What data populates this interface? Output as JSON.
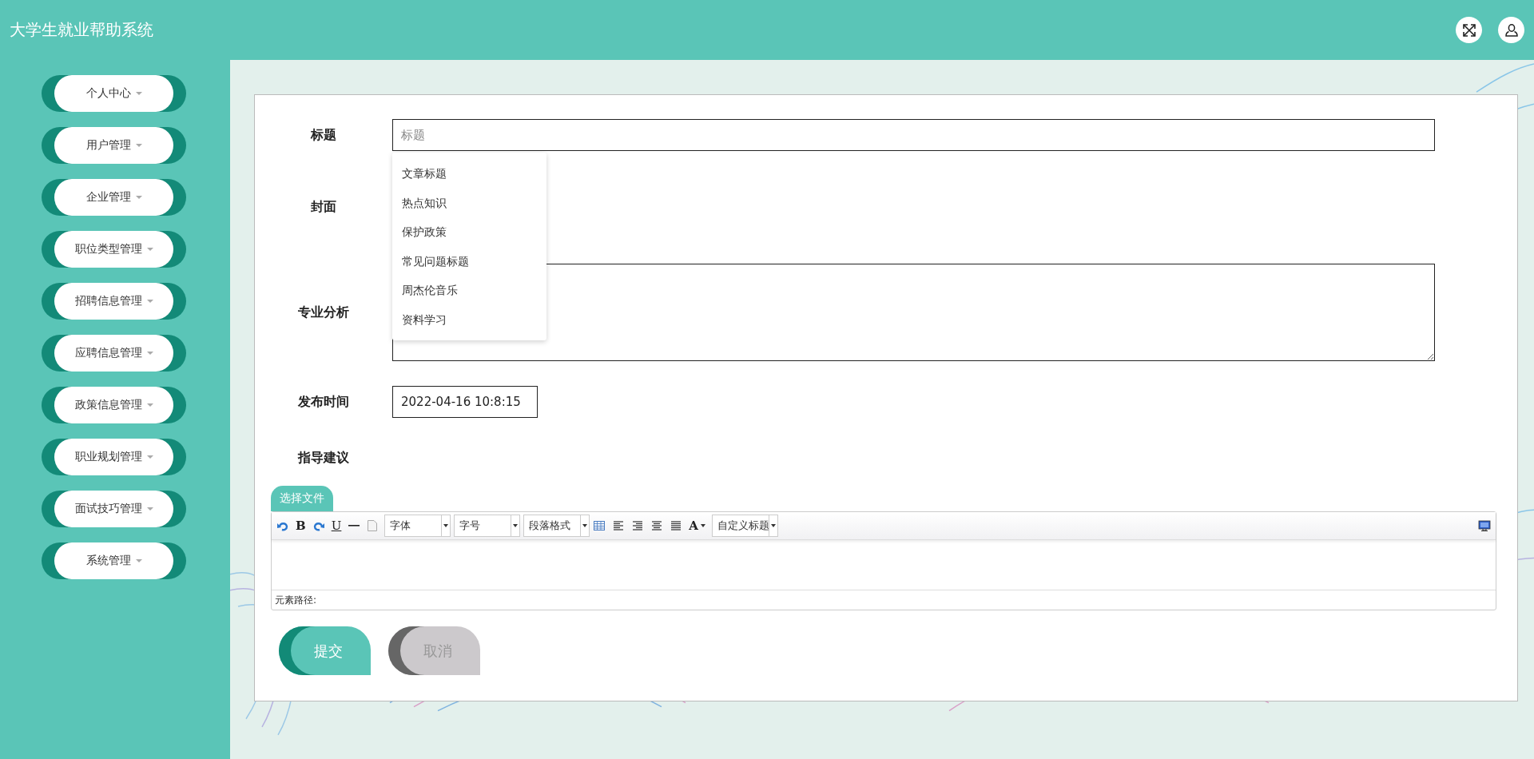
{
  "header": {
    "title": "大学生就业帮助系统"
  },
  "sidebar": {
    "items": [
      {
        "label": "个人中心"
      },
      {
        "label": "用户管理"
      },
      {
        "label": "企业管理"
      },
      {
        "label": "职位类型管理"
      },
      {
        "label": "招聘信息管理"
      },
      {
        "label": "应聘信息管理"
      },
      {
        "label": "政策信息管理"
      },
      {
        "label": "职业规划管理"
      },
      {
        "label": "面试技巧管理"
      },
      {
        "label": "系统管理"
      }
    ]
  },
  "form": {
    "title": {
      "label": "标题",
      "placeholder": "标题",
      "suggestions": [
        "文章标题",
        "热点知识",
        "保护政策",
        "常见问题标题",
        "周杰伦音乐",
        "资料学习"
      ]
    },
    "cover": {
      "label": "封面"
    },
    "analysis": {
      "label": "专业分析"
    },
    "publish_time": {
      "label": "发布时间",
      "value": "2022-04-16 10:8:15"
    },
    "advice": {
      "label": "指导建议",
      "upload_button": "选择文件",
      "path_label": "元素路径:",
      "toolbar": [
        {
          "kind": "undo"
        },
        {
          "kind": "bold",
          "label": "B"
        },
        {
          "kind": "redo"
        },
        {
          "kind": "underline",
          "label": "U"
        },
        {
          "kind": "rule"
        },
        {
          "kind": "page"
        },
        {
          "kind": "select",
          "label": "字体"
        },
        {
          "kind": "select",
          "label": "字号"
        },
        {
          "kind": "select",
          "label": "段落格式"
        },
        {
          "kind": "table"
        },
        {
          "kind": "align-left"
        },
        {
          "kind": "align-right"
        },
        {
          "kind": "align-center"
        },
        {
          "kind": "justify"
        },
        {
          "kind": "color",
          "label": "A"
        },
        {
          "kind": "select",
          "label": "自定义标题"
        }
      ]
    },
    "buttons": [
      {
        "label": "提交",
        "kind": "primary"
      },
      {
        "label": "取消",
        "kind": "cancel"
      }
    ]
  }
}
